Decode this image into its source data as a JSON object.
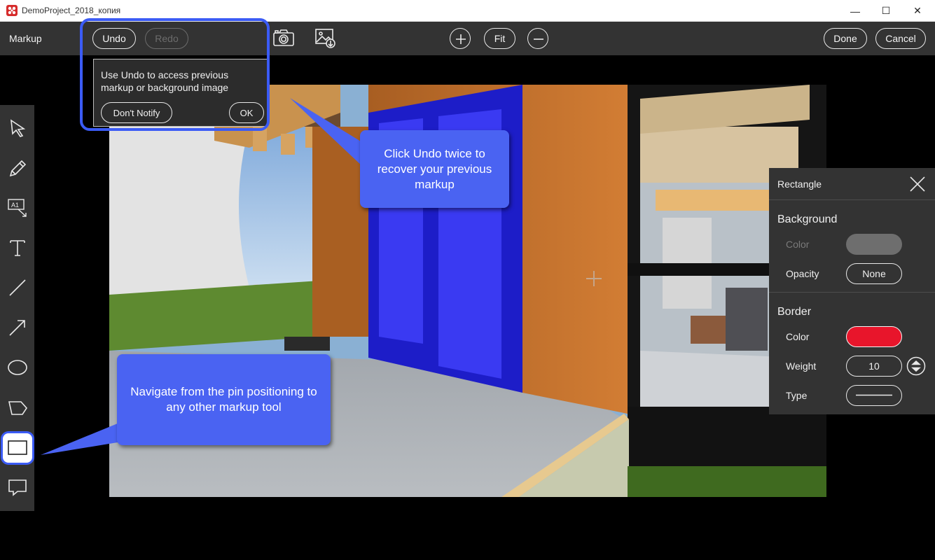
{
  "window": {
    "title": "DemoProject_2018_копия",
    "minimize_glyph": "—",
    "maximize_glyph": "☐",
    "close_glyph": "✕"
  },
  "toolbar": {
    "label": "Markup",
    "undo_label": "Undo",
    "redo_label": "Redo",
    "fit_label": "Fit",
    "done_label": "Done",
    "cancel_label": "Cancel",
    "icons": [
      "camera-icon",
      "image-download-icon",
      "zoom-in-icon",
      "zoom-out-icon"
    ]
  },
  "undo_tip": {
    "message": "Use Undo to access previous markup or background image",
    "dont_notify_label": "Don't Notify",
    "ok_label": "OK"
  },
  "callouts": {
    "undo_hint": "Click Undo twice to recover your previous markup",
    "tool_hint": "Navigate from the pin positioning to any other markup tool"
  },
  "tools": [
    "select-arrow-icon",
    "pencil-icon",
    "text-box-leader-icon",
    "text-icon",
    "line-icon",
    "arrow-icon",
    "ellipse-icon",
    "polygon-icon",
    "rectangle-icon",
    "comment-icon"
  ],
  "active_tool": "rectangle-icon",
  "properties": {
    "title": "Rectangle",
    "background": {
      "heading": "Background",
      "color_label": "Color",
      "color_value": "#6e6e6e",
      "opacity_label": "Opacity",
      "opacity_value": "None"
    },
    "border": {
      "heading": "Border",
      "color_label": "Color",
      "color_value": "#e8152b",
      "weight_label": "Weight",
      "weight_value": "10",
      "type_label": "Type"
    }
  },
  "colors": {
    "accent": "#3b5bf5",
    "callout": "#4a63f2",
    "toolbar_bg": "#333333"
  }
}
